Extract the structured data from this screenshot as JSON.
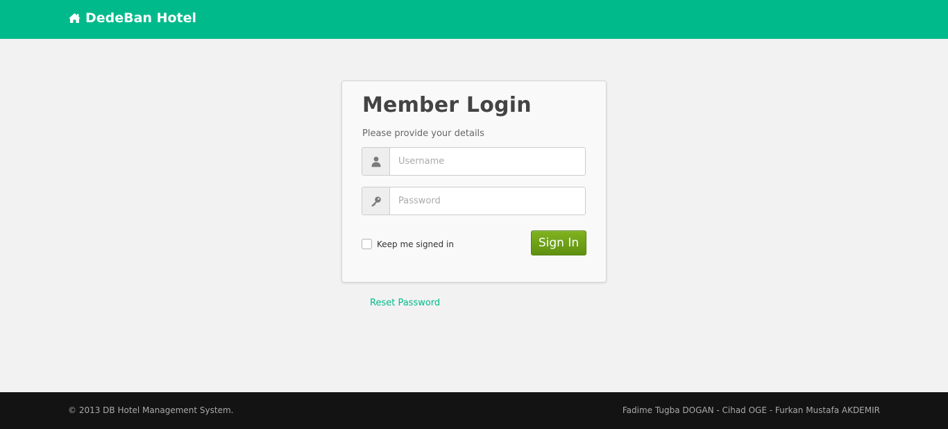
{
  "navbar": {
    "brand_icon": "home-icon",
    "brand_label": "DedeBan Hotel",
    "background_color": "#00ba8b"
  },
  "login": {
    "title": "Member Login",
    "subtitle": "Please provide your details",
    "username": {
      "icon": "user-icon",
      "placeholder": "Username",
      "value": ""
    },
    "password": {
      "icon": "key-icon",
      "placeholder": "Password",
      "value": ""
    },
    "remember_label": "Keep me signed in",
    "remember_checked": false,
    "signin_label": "Sign In",
    "signin_color": "#6ea318"
  },
  "reset_link": "Reset Password",
  "footer": {
    "copyright": "© 2013 DB Hotel Management System.",
    "authors": "Fadime Tugba DOGAN - Cihad OGE - Furkan Mustafa AKDEMIR"
  }
}
